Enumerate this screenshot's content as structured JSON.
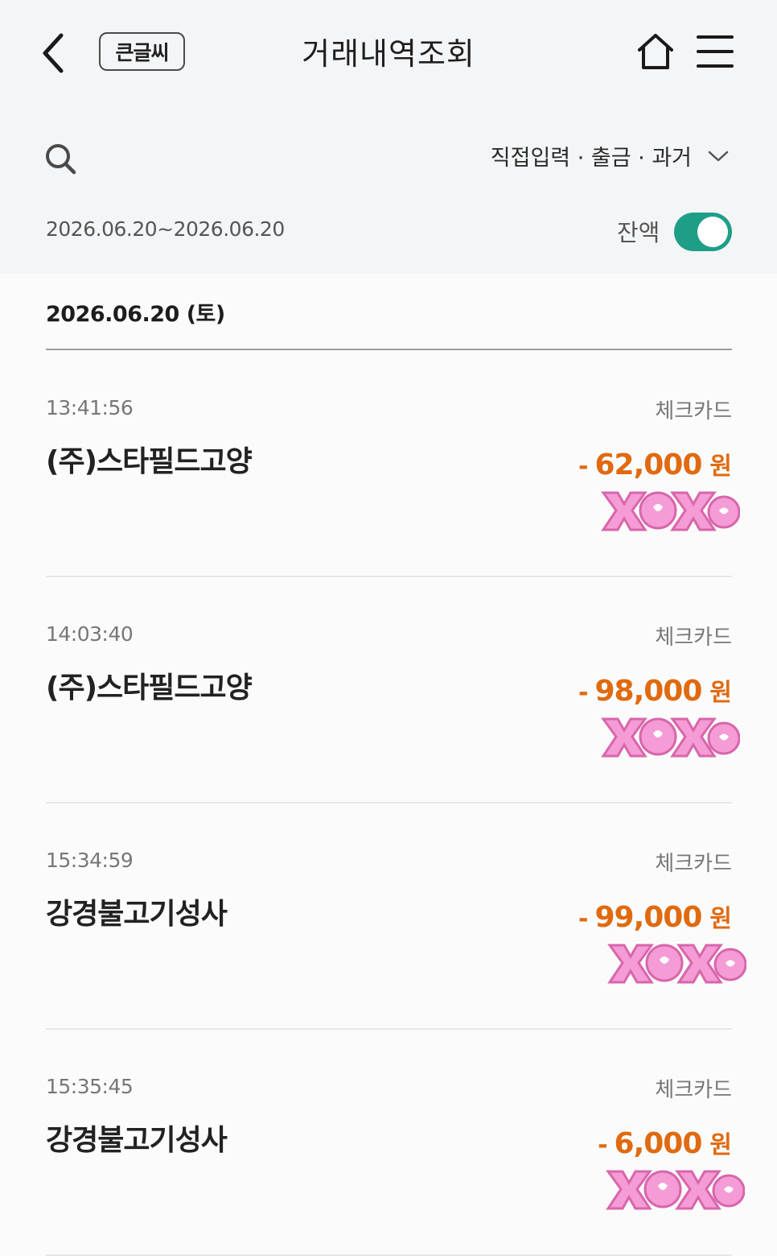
{
  "header": {
    "title": "거래내역조회",
    "big_text_label": "큰글씨"
  },
  "filter": {
    "label": "직접입력 · 출금 · 과거",
    "date_range": "2026.06.20~2026.06.20",
    "balance_label": "잔액",
    "balance_toggle_on": true
  },
  "list": {
    "date_header": "2026.06.20 (토)",
    "transactions": [
      {
        "time": "13:41:56",
        "card_type": "체크카드",
        "merchant": "(주)스타필드고양",
        "sign": "-",
        "amount": "62,000",
        "unit": "원"
      },
      {
        "time": "14:03:40",
        "card_type": "체크카드",
        "merchant": "(주)스타필드고양",
        "sign": "-",
        "amount": "98,000",
        "unit": "원"
      },
      {
        "time": "15:34:59",
        "card_type": "체크카드",
        "merchant": "강경불고기성사",
        "sign": "-",
        "amount": "99,000",
        "unit": "원"
      },
      {
        "time": "15:35:45",
        "card_type": "체크카드",
        "merchant": "강경불고기성사",
        "sign": "-",
        "amount": "6,000",
        "unit": "원"
      }
    ]
  },
  "colors": {
    "accent_toggle": "#1f9e87",
    "amount": "#e06a10",
    "sticker_pink": "#f59bd6"
  },
  "icons": [
    "back-arrow-icon",
    "home-icon",
    "menu-icon",
    "search-icon",
    "chevron-down-icon",
    "xoxo-sticker"
  ]
}
